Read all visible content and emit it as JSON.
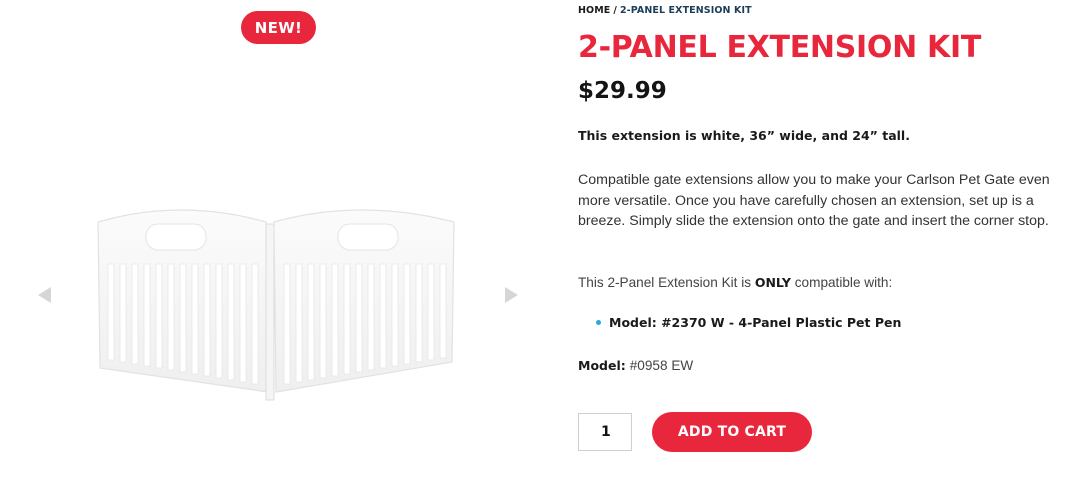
{
  "badge": {
    "label": "NEW!"
  },
  "gallery": {
    "prev_icon": "triangle-left-icon",
    "next_icon": "triangle-right-icon",
    "image_alt": "2-Panel Extension Kit"
  },
  "breadcrumb": {
    "home": "HOME",
    "separator": "/",
    "current": "2-PANEL EXTENSION KIT"
  },
  "product": {
    "title": "2-PANEL EXTENSION KIT",
    "price": "$29.99",
    "summary": "This extension is white, 36” wide, and 24” tall.",
    "description": "Compatible gate extensions allow you to make your Carlson Pet Gate even more versatile. Once you have carefully chosen an extension, set up is a breeze. Simply slide the extension onto the gate and insert the corner stop.",
    "compat_prefix": "This 2-Panel Extension Kit is ",
    "compat_emphasis": "ONLY",
    "compat_suffix": " compatible with:",
    "compatible_models": [
      "Model: #2370 W - 4-Panel Plastic Pet Pen"
    ],
    "model_label": "Model:",
    "model_value": "#0958 EW"
  },
  "cart": {
    "quantity": "1",
    "add_label": "ADD TO CART"
  },
  "colors": {
    "accent": "#e8263c",
    "bullet": "#29a8e0",
    "breadcrumb_current": "#1c3d5a"
  }
}
